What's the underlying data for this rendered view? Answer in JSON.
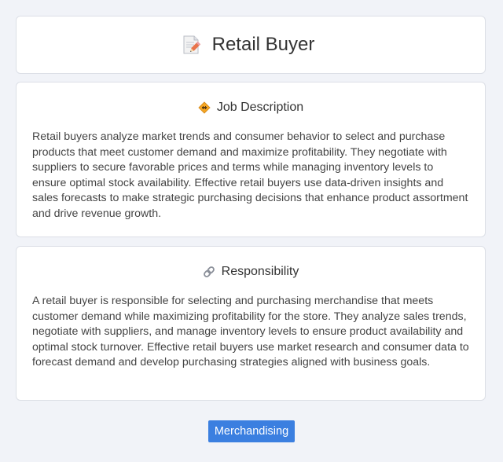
{
  "header": {
    "title": "Retail Buyer",
    "icon": "memo-pencil-icon"
  },
  "sections": [
    {
      "title": "Job Description",
      "icon": "construction-sign-icon",
      "body": "Retail buyers analyze market trends and consumer behavior to select and purchase products that meet customer demand and maximize profitability. They negotiate with suppliers to secure favorable prices and terms while managing inventory levels to ensure optimal stock availability. Effective retail buyers use data-driven insights and sales forecasts to make strategic purchasing decisions that enhance product assortment and drive revenue growth."
    },
    {
      "title": "Responsibility",
      "icon": "link-icon",
      "body": "A retail buyer is responsible for selecting and purchasing merchandise that meets customer demand while maximizing profitability for the store. They analyze sales trends, negotiate with suppliers, and manage inventory levels to ensure product availability and optimal stock turnover. Effective retail buyers use market research and consumer data to forecast demand and develop purchasing strategies aligned with business goals."
    }
  ],
  "tag": {
    "label": "Merchandising",
    "color": "#3b7fe0"
  },
  "colors": {
    "background": "#f1f3f8",
    "card": "#ffffff",
    "accent": "#3b7fe0"
  }
}
